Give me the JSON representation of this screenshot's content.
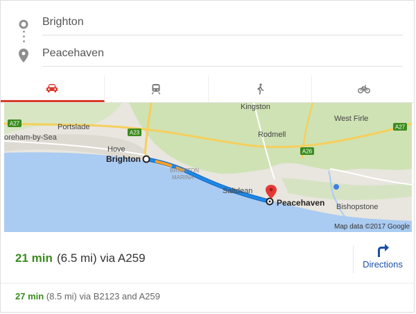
{
  "inputs": {
    "origin_value": "Brighton",
    "destination_value": "Peacehaven"
  },
  "modes": [
    {
      "name": "car-icon",
      "selected": true
    },
    {
      "name": "transit-icon",
      "selected": false
    },
    {
      "name": "walk-icon",
      "selected": false
    },
    {
      "name": "bike-icon",
      "selected": false
    }
  ],
  "map": {
    "places": {
      "kingston": "Kingston",
      "west_firle": "West Firle",
      "portslade": "Portslade",
      "rodmell": "Rodmell",
      "oreham": "oreham-by-Sea",
      "hove": "Hove",
      "brighton": "Brighton",
      "marina1": "BRIGHTON",
      "marina2": "MARINA",
      "saltdean": "Saltdean",
      "peacehaven": "Peacehaven",
      "bishopstone": "Bishopstone"
    },
    "roads": {
      "a27_left": "A27",
      "a23": "A23",
      "a26": "A26",
      "a27_right": "A27"
    },
    "attribution": "Map data ©2017 Google"
  },
  "route_main": {
    "time": "21 min",
    "details": "(6.5 mi) via A259",
    "directions_label": "Directions"
  },
  "route_alt": {
    "time": "27 min",
    "details": "(8.5 mi) via B2123 and A259"
  },
  "colors": {
    "route_time": "#3a8b1e",
    "route_line": "#1e88e5",
    "traffic_orange": "#f4a12a",
    "sea": "#aacbf2",
    "land": "#e8e6df",
    "park": "#cfe2b4",
    "active_tab": "#d93a2b",
    "link_blue": "#1a4fa8"
  }
}
